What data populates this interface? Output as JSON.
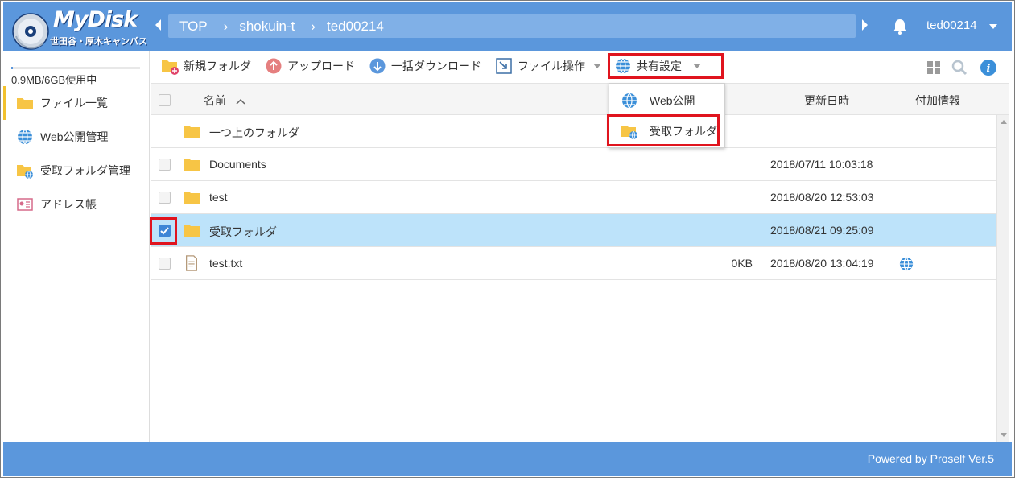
{
  "header": {
    "logo_text": "MyDisk",
    "logo_sub": "世田谷・厚木キャンパス",
    "breadcrumb": [
      "TOP",
      "shokuin-t",
      "ted00214"
    ],
    "user": "ted00214"
  },
  "sidebar": {
    "quota": "0.9MB/6GB使用中",
    "quota_fraction": 0.0002,
    "items": [
      {
        "label": "ファイル一覧",
        "icon": "folder-icon",
        "active": true
      },
      {
        "label": "Web公開管理",
        "icon": "globe-icon",
        "active": false
      },
      {
        "label": "受取フォルダ管理",
        "icon": "receive-folder-icon",
        "active": false
      },
      {
        "label": "アドレス帳",
        "icon": "address-book-icon",
        "active": false
      }
    ]
  },
  "toolbar": {
    "new_folder": "新規フォルダ",
    "upload": "アップロード",
    "bulk_download": "一括ダウンロード",
    "file_ops": "ファイル操作",
    "share_settings": "共有設定"
  },
  "table": {
    "headers": {
      "name": "名前",
      "updated": "更新日時",
      "extra": "付加情報"
    },
    "rows": [
      {
        "name": "一つ上のフォルダ",
        "type": "folder",
        "size": "",
        "date": "",
        "checkbox": false,
        "checked": false
      },
      {
        "name": "Documents",
        "type": "folder",
        "size": "",
        "date": "2018/07/11 10:03:18",
        "checkbox": true,
        "checked": false
      },
      {
        "name": "test",
        "type": "folder",
        "size": "",
        "date": "2018/08/20 12:53:03",
        "checkbox": true,
        "checked": false
      },
      {
        "name": "受取フォルダ",
        "type": "folder",
        "size": "",
        "date": "2018/08/21 09:25:09",
        "checkbox": true,
        "checked": true
      },
      {
        "name": "test.txt",
        "type": "file",
        "size": "0KB",
        "date": "2018/08/20 13:04:19",
        "checkbox": true,
        "checked": false,
        "extra": "globe-icon"
      }
    ]
  },
  "dropdown": {
    "items": [
      {
        "label": "Web公開",
        "icon": "globe-icon"
      },
      {
        "label": "受取フォルダ",
        "icon": "receive-folder-icon"
      }
    ]
  },
  "footer": {
    "powered_prefix": "Powered by ",
    "powered_link": "Proself Ver.5"
  },
  "colors": {
    "header_blue": "#5b97dc",
    "highlight_red": "#e0141e",
    "selected_row": "#bde3fa",
    "folder_yellow": "#f7c545"
  }
}
